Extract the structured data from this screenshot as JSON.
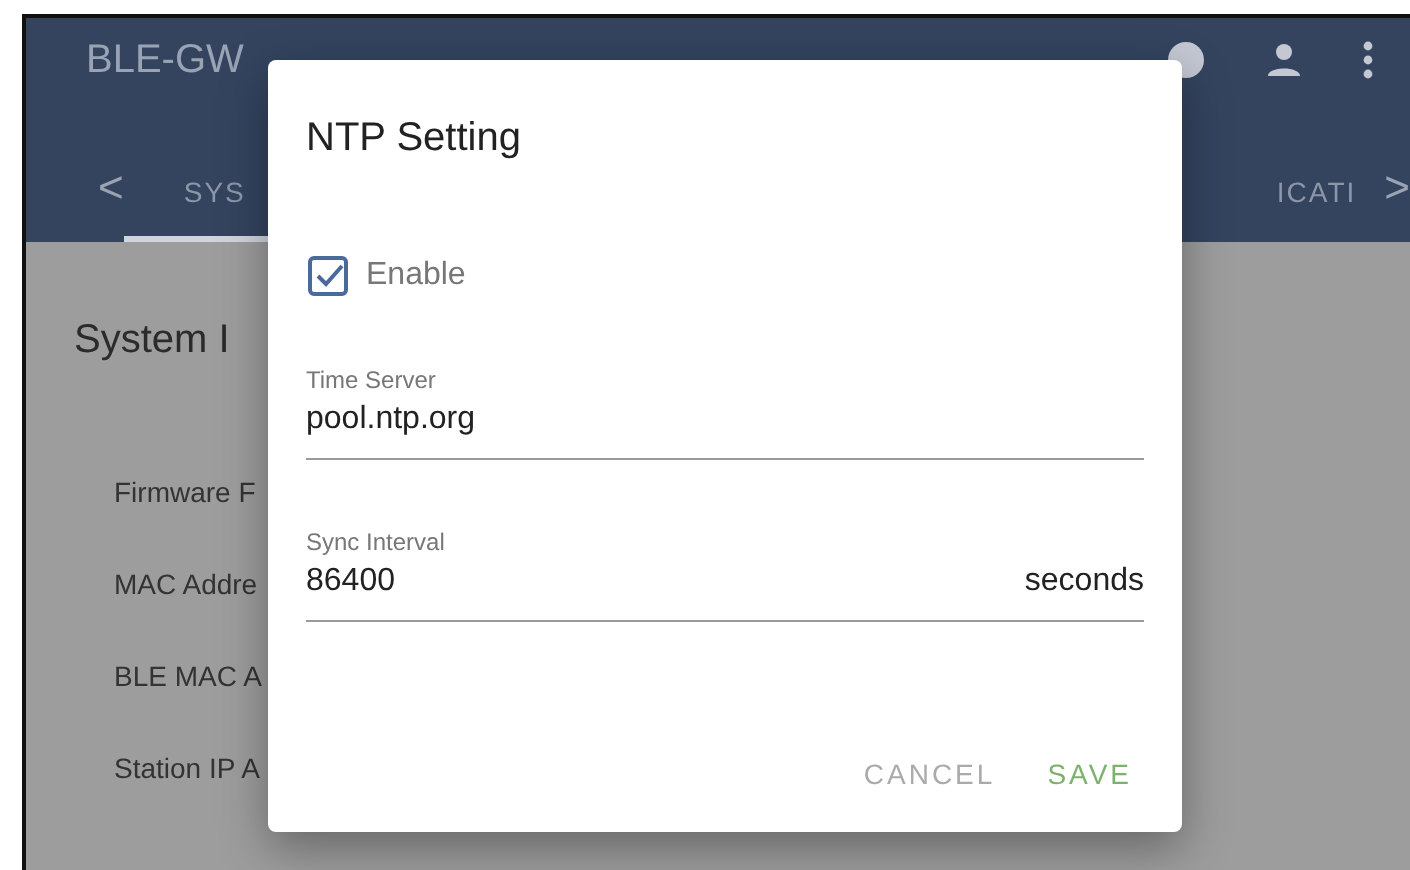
{
  "app_bar": {
    "title": "BLE-GW"
  },
  "tabs": [
    {
      "label": "SYS",
      "selected": true
    },
    {
      "label": "ICATI",
      "selected": false
    }
  ],
  "tab_scroll": {
    "prev": "<",
    "next": ">"
  },
  "page": {
    "heading": "System I",
    "rows": [
      "Firmware F",
      "MAC Addre",
      "BLE MAC A",
      "Station IP A"
    ]
  },
  "dialog": {
    "title": "NTP Setting",
    "enable": {
      "label": "Enable",
      "checked": true
    },
    "fields": [
      {
        "label": "Time Server",
        "value": "pool.ntp.org"
      },
      {
        "label": "Sync Interval",
        "value": "86400",
        "suffix": "seconds"
      }
    ],
    "buttons": [
      {
        "label": "CANCEL",
        "kind": "cancel"
      },
      {
        "label": "SAVE",
        "kind": "save"
      }
    ]
  }
}
